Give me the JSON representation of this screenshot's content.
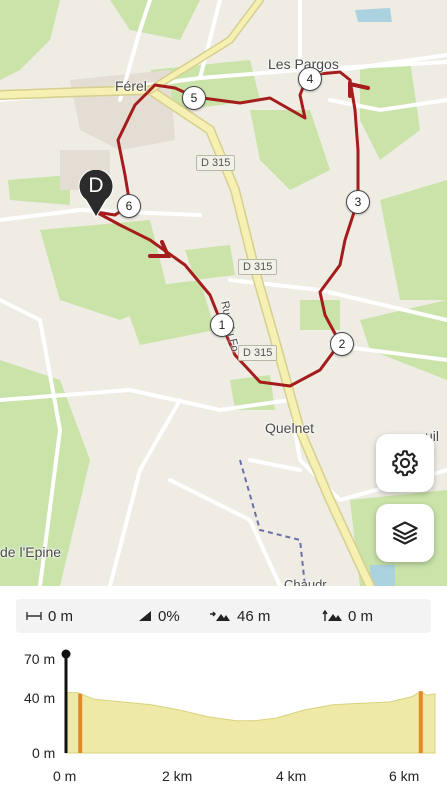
{
  "map": {
    "places": {
      "ferel": "Férel",
      "les_pargos": "Les Pargos",
      "quelnet": "Quelnet",
      "epine": "de l'Epine",
      "quil": "uil",
      "bottom_text": "Chaudr..."
    },
    "roads": {
      "d315_a": "D 315",
      "d315_b": "D 315",
      "d315_c": "D 315",
      "street": "Rue du Fo"
    },
    "waypoints": [
      "1",
      "2",
      "3",
      "4",
      "5",
      "6"
    ],
    "start_marker": "D",
    "route_color": "#a51c1c"
  },
  "buttons": {
    "settings_icon": "gear-icon",
    "layers_icon": "layers-icon"
  },
  "stats": {
    "distance": "0 m",
    "grade": "0%",
    "ascent": "46 m",
    "elevation": "0 m"
  },
  "chart_data": {
    "type": "area",
    "y_ticks": [
      "70 m",
      "40 m",
      "0 m"
    ],
    "x_ticks": [
      "0 m",
      "2 km",
      "4 km",
      "6 km"
    ],
    "ylim": [
      0,
      70
    ],
    "xlim": [
      0,
      6.5
    ],
    "x": [
      0,
      0.2,
      0.5,
      1.0,
      1.5,
      2.0,
      2.5,
      3.0,
      3.3,
      3.7,
      4.2,
      4.7,
      5.2,
      5.7,
      6.1,
      6.25,
      6.35,
      6.5
    ],
    "y": [
      45,
      45,
      40,
      38,
      36,
      32,
      27,
      24,
      24,
      26,
      32,
      36,
      37,
      38,
      42,
      46,
      43,
      44
    ],
    "markers": [
      0.25,
      6.25
    ],
    "current_position": 0,
    "fill_color": "#eee9a6",
    "marker_color": "#e0892a"
  }
}
